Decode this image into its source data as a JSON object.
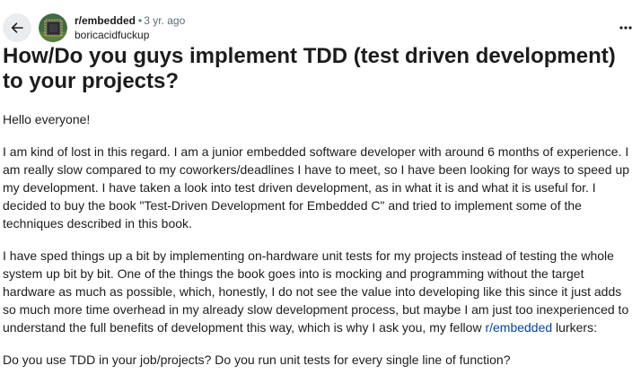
{
  "post": {
    "subreddit": "r/embedded",
    "separator": "•",
    "age": "3 yr. ago",
    "author": "boricacidfuckup",
    "title": "How/Do you guys implement TDD (test driven development) to your projects?",
    "paragraphs": {
      "p1": "Hello everyone!",
      "p2": "I am kind of lost in this regard. I am a junior embedded software developer with around 6 months of experience. I am really slow compared to my coworkers/deadlines I have to meet, so I have been looking for ways to speed up my development. I have taken a look into test driven development, as in what it is and what it is useful for. I decided to buy the book \"Test-Driven Development for Embedded C\" and tried to implement some of the techniques described in this book.",
      "p3_before_link": "I have sped things up a bit by implementing on-hardware unit tests for my projects instead of testing the whole system up bit by bit. One of the things the book goes into is mocking and programming without the target hardware as much as possible, which, honestly, I do not see the value into developing like this since it just adds so much more time overhead in my already slow development process, but maybe I am just too inexperienced to understand the full benefits of development this way, which is why I ask you, my fellow ",
      "p3_link": "r/embedded",
      "p3_after_link": " lurkers:",
      "p4": "Do you use TDD in your job/projects? Do you run unit tests for every single line of function?"
    }
  },
  "icons": {
    "back": "arrow-left-icon",
    "more": "ellipsis-icon",
    "avatar": "subreddit-avatar-chip"
  },
  "colors": {
    "link": "#0045ac",
    "meta_gray": "#576f76",
    "back_button_bg": "#e9edf0",
    "text": "#1c1c1c"
  }
}
